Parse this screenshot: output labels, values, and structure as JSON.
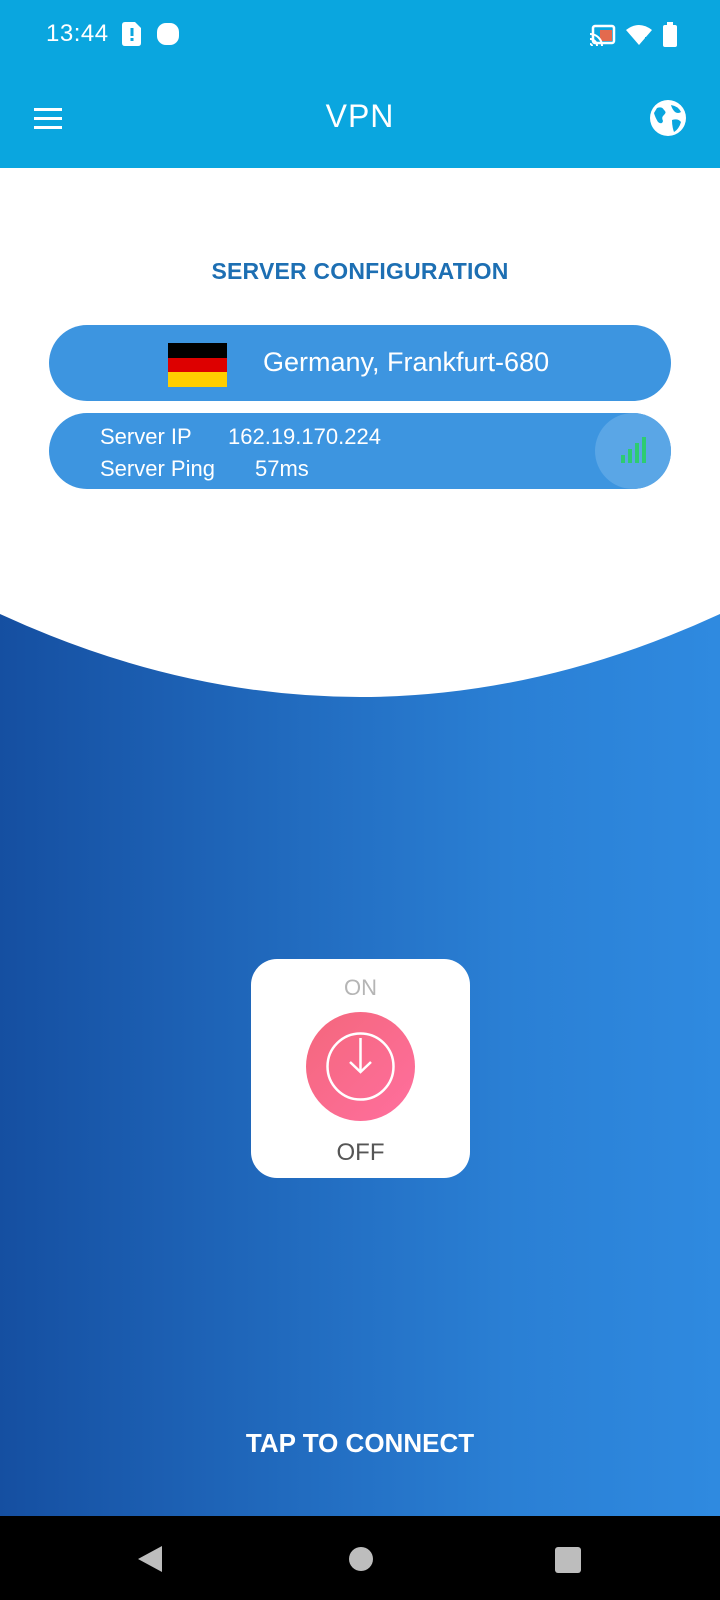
{
  "status_bar": {
    "time": "13:44"
  },
  "app_bar": {
    "title": "VPN"
  },
  "server_configuration": {
    "heading": "SERVER CONFIGURATION",
    "location": "Germany, Frankfurt-680",
    "flag_icon": "germany-flag-icon",
    "ip_label": "Server IP",
    "ip_value": "162.19.170.224",
    "ping_label": "Server Ping",
    "ping_value": "57ms"
  },
  "power": {
    "on_label": "ON",
    "off_label": "OFF"
  },
  "connect_label": "TAP TO CONNECT",
  "colors": {
    "primary": "#0aa6df",
    "accent_blue": "#3d95e0",
    "heading_blue": "#1d6fb3",
    "power_pink": "#f4677c",
    "signal_green": "#2ecc71"
  }
}
